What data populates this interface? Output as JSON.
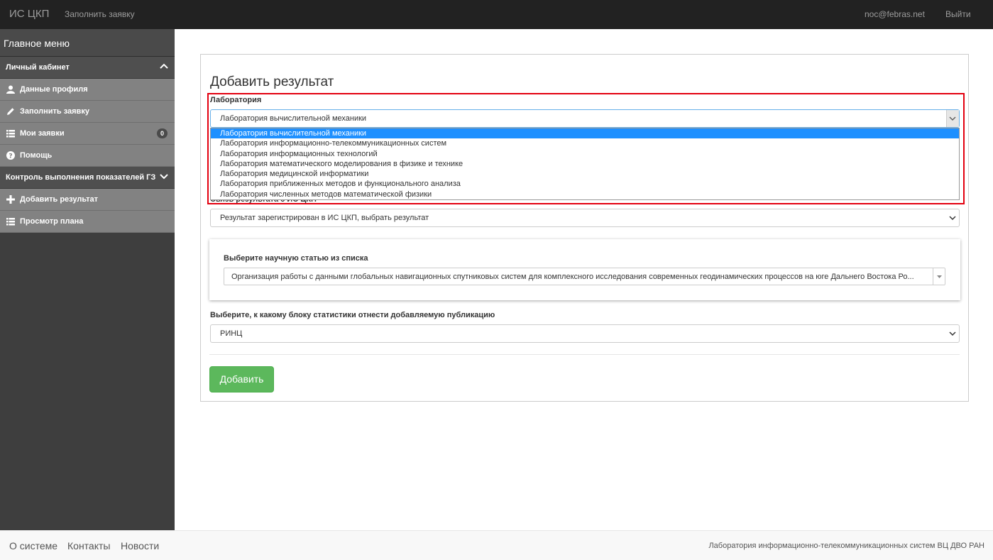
{
  "navbar": {
    "brand": "ИС ЦКП",
    "fill_request": "Заполнить заявку",
    "user_email": "noc@febras.net",
    "logout": "Выйти"
  },
  "sidebar": {
    "title": "Главное меню",
    "section_cabinet": "Личный кабинет",
    "items_cabinet": [
      {
        "label": "Данные профиля",
        "icon": "user-icon"
      },
      {
        "label": "Заполнить заявку",
        "icon": "pencil-icon"
      },
      {
        "label": "Мои заявки",
        "icon": "list-icon",
        "badge": "0"
      },
      {
        "label": "Помощь",
        "icon": "question-icon"
      }
    ],
    "section_control": "Контроль выполнения показателей ГЗ",
    "items_control": [
      {
        "label": "Добавить результат",
        "icon": "plus-icon"
      },
      {
        "label": "Просмотр плана",
        "icon": "list-icon"
      }
    ]
  },
  "form": {
    "title": "Добавить результат",
    "lab_label": "Лаборатория",
    "lab_value": "Лаборатория вычислительной механики",
    "lab_options": [
      "Лаборатория вычислительной механики",
      "Лаборатория информационно-телекоммуникационных систем",
      "Лаборатория информационных технологий",
      "Лаборатория математического моделирования в физике и технике",
      "Лаборатория медицинской информатики",
      "Лаборатория приближенных методов и функционального анализа",
      "Лаборатория численных методов математической физики"
    ],
    "link_label": "Связь результата с ИС ЦКП",
    "link_value": "Результат зарегистрирован в ИС ЦКП, выбрать результат",
    "article_label": "Выберите научную статью из списка",
    "article_value": "Организация работы с данными глобальных навигационных спутниковых систем для комплексного исследования современных геодинамических процессов на юге Дальнего Востока Ро...",
    "block_label": "Выберите, к какому блоку статистики отнести добавляемую публикацию",
    "block_value": "РИНЦ",
    "submit": "Добавить"
  },
  "footer": {
    "about": "О системе",
    "contacts": "Контакты",
    "news": "Новости",
    "org": "Лаборатория информационно-телекоммуникационных систем ВЦ ДВО РАН"
  },
  "colors": {
    "navbar_bg": "#222222",
    "sidebar_bg": "#3e3e3e",
    "sidebar_item_bg": "#828282",
    "highlight_red": "#e3000f",
    "option_selected": "#1e90ff",
    "button_green": "#5cb85c"
  }
}
